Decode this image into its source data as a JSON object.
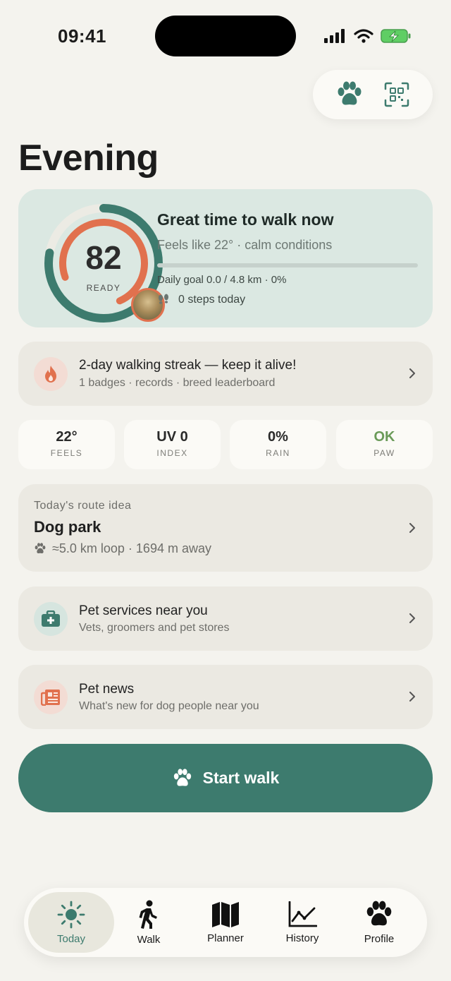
{
  "status": {
    "time": "09:41"
  },
  "page": {
    "title": "Evening"
  },
  "readiness": {
    "score": "82",
    "score_label": "READY",
    "ring_outer_fraction": 0.78,
    "ring_inner_fraction": 0.74,
    "headline": "Great time to walk now",
    "subline": "Feels like 22° · calm conditions",
    "goal_progress": 0,
    "goal_text": "Daily goal 0.0 / 4.8 km · 0%",
    "steps_text": "0 steps today"
  },
  "streak": {
    "title": "2-day walking streak — keep it alive!",
    "subtitle": "1 badges · records · breed leaderboard"
  },
  "metrics": [
    {
      "value": "22°",
      "label": "FEELS",
      "color": "#2a2a2a"
    },
    {
      "value": "UV 0",
      "label": "INDEX",
      "color": "#2a2a2a"
    },
    {
      "value": "0%",
      "label": "RAIN",
      "color": "#2a2a2a"
    },
    {
      "value": "OK",
      "label": "PAW",
      "color": "#6a9a58"
    }
  ],
  "route": {
    "eyebrow": "Today's route idea",
    "title": "Dog park",
    "detail": "≈5.0 km loop · 1694 m away"
  },
  "services": {
    "title": "Pet services near you",
    "subtitle": "Vets, groomers and pet stores"
  },
  "news": {
    "title": "Pet news",
    "subtitle": "What's new for dog people near you"
  },
  "start_button": {
    "label": "Start walk"
  },
  "tabs": [
    {
      "label": "Today",
      "icon": "sun-icon"
    },
    {
      "label": "Walk",
      "icon": "walker-icon"
    },
    {
      "label": "Planner",
      "icon": "map-icon"
    },
    {
      "label": "History",
      "icon": "line-chart-icon"
    },
    {
      "label": "Profile",
      "icon": "paw-icon"
    }
  ],
  "colors": {
    "accent": "#3d7b6e",
    "ring_inner": "#e1714e",
    "background": "#f4f3ee"
  }
}
